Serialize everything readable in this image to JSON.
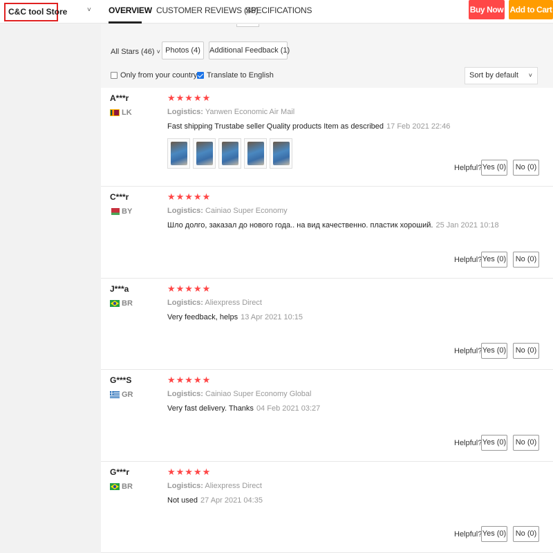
{
  "header": {
    "store_name": "C&C tool Store",
    "store_caret": "˅",
    "tabs": [
      {
        "label": "OVERVIEW",
        "active": true
      },
      {
        "label": "CUSTOMER REVIEWS (46)",
        "active": false
      },
      {
        "label": "SPECIFICATIONS",
        "active": false
      }
    ],
    "buy_now": "Buy Now",
    "add_to_cart": "Add to Cart",
    "colors": {
      "buy_now": "#ff4747",
      "add_to_cart": "#ff9c00",
      "highlight": "#e02020"
    }
  },
  "filters": {
    "all_stars": "All Stars (46)",
    "all_stars_caret": "˅",
    "photos": "Photos (4)",
    "additional_feedback": "Additional Feedback (1)",
    "only_country": {
      "label": "Only from your country",
      "checked": false
    },
    "translate": {
      "label": "Translate to English",
      "checked": true
    },
    "sort": "Sort by default",
    "sort_caret": "˅"
  },
  "review_ui": {
    "helpful_label": "Helpful?",
    "logistics_label": "Logistics:",
    "star_glyphs": "★★★★★",
    "star_color": "#ff4747"
  },
  "reviews": [
    {
      "user": "A***r",
      "country": "LK",
      "flag": "sri-lanka-flag",
      "stars": 5,
      "logistics": "Yanwen Economic Air Mail",
      "text": "Fast shipping Trustabe seller Quality products Item as described",
      "date": "17 Feb 2021 22:46",
      "photos": 5,
      "yes": "Yes (0)",
      "no": "No (0)"
    },
    {
      "user": "C***r",
      "country": "BY",
      "flag": "belarus-flag",
      "stars": 5,
      "logistics": "Cainiao Super Economy",
      "text": "Шло долго, заказал до нового года.. на вид качественно. пластик хороший.",
      "date": "25 Jan 2021 10:18",
      "photos": 0,
      "yes": "Yes (0)",
      "no": "No (0)"
    },
    {
      "user": "J***a",
      "country": "BR",
      "flag": "brazil-flag",
      "stars": 5,
      "logistics": "Aliexpress Direct",
      "text": "Very feedback, helps",
      "date": "13 Apr 2021 10:15",
      "photos": 0,
      "yes": "Yes (0)",
      "no": "No (0)"
    },
    {
      "user": "G***S",
      "country": "GR",
      "flag": "greece-flag",
      "stars": 5,
      "logistics": "Cainiao Super Economy Global",
      "text": "Very fast delivery. Thanks",
      "date": "04 Feb 2021 03:27",
      "photos": 0,
      "yes": "Yes (0)",
      "no": "No (0)"
    },
    {
      "user": "G***r",
      "country": "BR",
      "flag": "brazil-flag",
      "stars": 5,
      "logistics": "Aliexpress Direct",
      "text": "Not used",
      "date": "27 Apr 2021 04:35",
      "photos": 0,
      "yes": "Yes (0)",
      "no": "No (0)"
    }
  ]
}
